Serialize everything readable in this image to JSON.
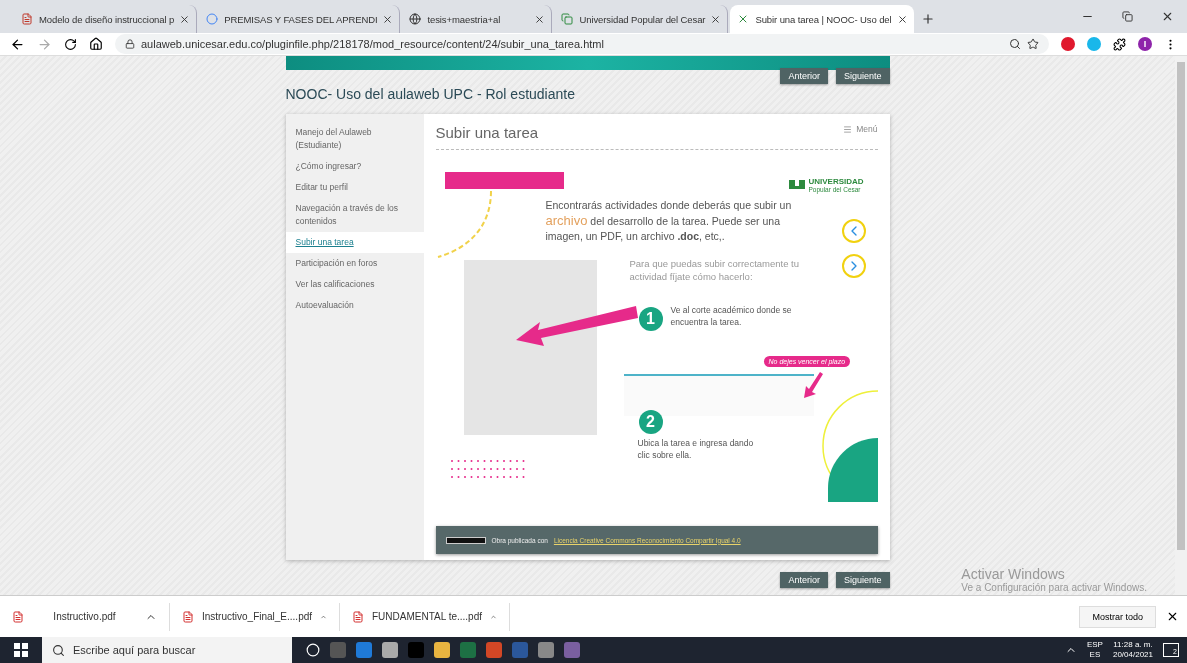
{
  "browser": {
    "tabs": [
      {
        "title": "Modelo de diseño instruccional p",
        "selected": false
      },
      {
        "title": "PREMISAS Y FASES DEL APRENDI",
        "selected": false
      },
      {
        "title": "tesis+maestria+al",
        "selected": false
      },
      {
        "title": "Universidad Popular del Cesar",
        "selected": false
      },
      {
        "title": "Subir una tarea | NOOC- Uso del",
        "selected": true
      }
    ],
    "address": "aulaweb.unicesar.edu.co/pluginfile.php/218178/mod_resource/content/24/subir_una_tarea.html",
    "profile_initial": "I"
  },
  "page": {
    "course_title": "NOOC- Uso del aulaweb UPC - Rol estudiante",
    "nav_top": [
      "Anterior",
      "Siguiente"
    ],
    "sidebar": [
      {
        "label": "Manejo del Aulaweb (Estudiante)",
        "selected": false
      },
      {
        "label": "¿Cómo ingresar?",
        "selected": false
      },
      {
        "label": "Editar tu perfil",
        "selected": false
      },
      {
        "label": "Navegación a través de los contenidos",
        "selected": false
      },
      {
        "label": "Subir una tarea",
        "selected": true
      },
      {
        "label": "Participación en foros",
        "selected": false
      },
      {
        "label": "Ver las calificaciones",
        "selected": false
      },
      {
        "label": "Autoevaluación",
        "selected": false
      }
    ],
    "content_title": "Subir una tarea",
    "menu_label": "Menú",
    "slide": {
      "logo_title": "UNIVERSIDAD",
      "logo_subtitle": "Popular del Cesar",
      "intro": [
        {
          "text": "Encontrarás actividades donde deberás que subir un ",
          "kind": "plain"
        },
        {
          "text": "archivo",
          "kind": "highlight"
        },
        {
          "text": " del desarrollo de la tarea. Puede ser una imagen, un PDF, un archivo **.doc**, etc,.",
          "kind": "plain"
        }
      ],
      "lead": "Para que puedas subir correctamente tu actividad fíjate cómo hacerlo:",
      "steps": [
        {
          "number": "1",
          "text": "Ve al corte académico donde se encuentra la tarea."
        },
        {
          "number": "2",
          "text": "Ubica la tarea e ingresa dando clic sobre ella."
        }
      ],
      "callout": "No dejes  vencer el plazo"
    },
    "footer": {
      "text": "Obra publicada con ",
      "link": "Licencia Creative Commons Reconocimiento Compartir Igual 4.0"
    },
    "nav_bottom": [
      "Anterior",
      "Siguiente"
    ]
  },
  "activation_notice": {
    "title": "Activar Windows",
    "text": "Ve a Configuración para activar Windows."
  },
  "downloads": {
    "items": [
      "Instructivo.pdf",
      "Instructivo_Final_E....pdf",
      "FUNDAMENTAL te....pdf"
    ],
    "show_all": "Mostrar todo"
  },
  "taskbar": {
    "search_placeholder": "Escribe aquí para buscar",
    "lang_top": "ESP",
    "lang_bottom": "ES",
    "time": "11:28 a. m.",
    "date": "20/04/2021",
    "notifications": "2"
  }
}
